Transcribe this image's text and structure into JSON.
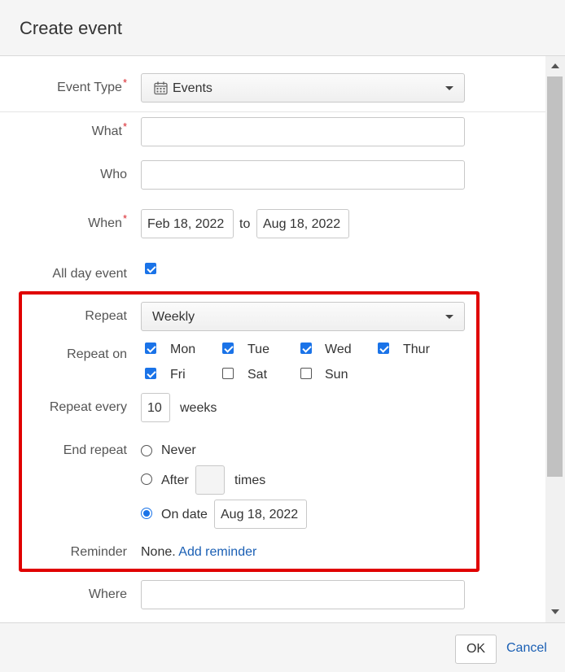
{
  "dialog": {
    "title": "Create event"
  },
  "form": {
    "event_type": {
      "label": "Event Type",
      "required_mark": "*",
      "value": "Events",
      "icon": "calendar-icon"
    },
    "what": {
      "label": "What",
      "required_mark": "*",
      "value": ""
    },
    "who": {
      "label": "Who",
      "value": ""
    },
    "when": {
      "label": "When",
      "required_mark": "*",
      "start": "Feb 18, 2022",
      "separator": "to",
      "end": "Aug 18, 2022"
    },
    "all_day": {
      "label": "All day event",
      "checked": true
    },
    "repeat": {
      "label": "Repeat",
      "value": "Weekly"
    },
    "repeat_on": {
      "label": "Repeat on",
      "days": [
        {
          "label": "Mon",
          "checked": true
        },
        {
          "label": "Tue",
          "checked": true
        },
        {
          "label": "Wed",
          "checked": true
        },
        {
          "label": "Thur",
          "checked": true
        },
        {
          "label": "Fri",
          "checked": true
        },
        {
          "label": "Sat",
          "checked": false
        },
        {
          "label": "Sun",
          "checked": false
        }
      ]
    },
    "repeat_every": {
      "label": "Repeat every",
      "value": "10",
      "unit": "weeks"
    },
    "end_repeat": {
      "label": "End repeat",
      "never_label": "Never",
      "after_label": "After",
      "after_value": "",
      "times_label": "times",
      "on_date_label": "On date",
      "on_date_value": "Aug 18, 2022",
      "selected": "on_date"
    },
    "reminder": {
      "label": "Reminder",
      "value": "None.",
      "add_link": "Add reminder"
    },
    "where": {
      "label": "Where",
      "value": ""
    }
  },
  "footer": {
    "ok_label": "OK",
    "cancel_label": "Cancel"
  },
  "colors": {
    "highlight": "#e00000",
    "accent": "#1a73e8",
    "required": "#d9242b",
    "link": "#1a5fb4"
  }
}
